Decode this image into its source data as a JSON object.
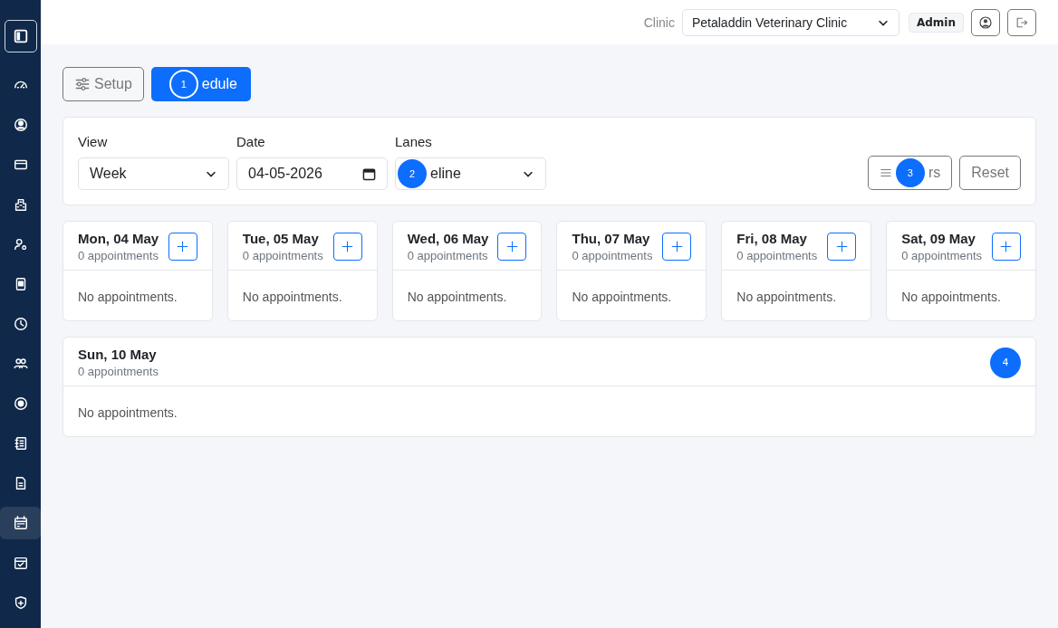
{
  "sidebar": {
    "items": [
      {
        "selected": false
      },
      {
        "selected": false
      },
      {
        "selected": false
      },
      {
        "selected": false
      },
      {
        "selected": false
      },
      {
        "selected": false
      },
      {
        "selected": false
      },
      {
        "selected": false
      },
      {
        "selected": false
      },
      {
        "selected": false
      },
      {
        "selected": false
      },
      {
        "selected": true
      },
      {
        "selected": false
      },
      {
        "selected": false
      }
    ]
  },
  "topbar": {
    "clinic_label": "Clinic",
    "clinic_value": "Petaladdin Veterinary Clinic",
    "role": "Admin"
  },
  "actions": [
    {
      "kind": "setup",
      "label": "Setup"
    },
    {
      "kind": "schedule",
      "label": "edule",
      "marker": "1"
    }
  ],
  "filters": {
    "view": {
      "label": "View",
      "value": "Week"
    },
    "date": {
      "label": "Date",
      "value": "04-05-2026"
    },
    "lanes": {
      "label": "Lanes",
      "value": "eline",
      "marker": "2"
    },
    "filters_button": {
      "label": "rs",
      "marker": "3"
    },
    "reset_button": {
      "label": "Reset"
    }
  },
  "days": [
    {
      "title": "Mon, 04 May",
      "count": "0 appointments",
      "empty": "No appointments."
    },
    {
      "title": "Tue, 05 May",
      "count": "0 appointments",
      "empty": "No appointments."
    },
    {
      "title": "Wed, 06 May",
      "count": "0 appointments",
      "empty": "No appointments."
    },
    {
      "title": "Thu, 07 May",
      "count": "0 appointments",
      "empty": "No appointments."
    },
    {
      "title": "Fri, 08 May",
      "count": "0 appointments",
      "empty": "No appointments."
    },
    {
      "title": "Sat, 09 May",
      "count": "0 appointments",
      "empty": "No appointments."
    },
    {
      "title": "Sun, 10 May",
      "count": "0 appointments",
      "empty": "No appointments.",
      "marker": "4"
    }
  ]
}
